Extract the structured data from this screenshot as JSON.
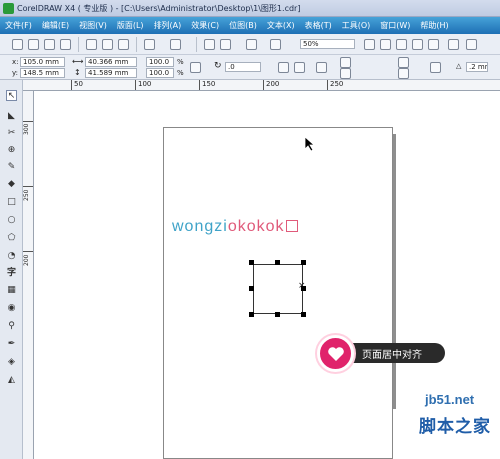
{
  "window": {
    "title": "CorelDRAW X4 ( 专业版 ) - [C:\\Users\\Administrator\\Desktop\\1\\图形1.cdr]"
  },
  "menu": [
    "文件(F)",
    "编辑(E)",
    "视图(V)",
    "版面(L)",
    "排列(A)",
    "效果(C)",
    "位图(B)",
    "文本(X)",
    "表格(T)",
    "工具(O)",
    "窗口(W)",
    "帮助(H)"
  ],
  "toolbar": {
    "zoom_value": "50%"
  },
  "property_bar": {
    "x_label": "x:",
    "x_value": "105.0 mm",
    "y_label": "y:",
    "y_value": "148.5 mm",
    "width_value": "40.366 mm",
    "height_value": "41.589 mm",
    "scale_x": "100.0",
    "scale_y": "100.0",
    "percent": "%",
    "rotation_value": ".0",
    "outline_value": ".2 mm"
  },
  "ruler": {
    "h_numbers": [
      "50",
      "100",
      "150",
      "200",
      "250"
    ],
    "v_numbers": [
      "300",
      "250",
      "200"
    ]
  },
  "canvas": {
    "logo_text_blue": "wongzi",
    "logo_text_pink": "okokok",
    "center_mark": "×"
  },
  "callout": {
    "text": "页面居中对齐"
  },
  "watermark": {
    "line1": "jb51.net",
    "line2": "脚本之家"
  },
  "colors": {
    "menubar": "#1e6fb5",
    "accent_pink": "#e0236b",
    "logo_blue": "#3fa3c8",
    "logo_pink": "#e05a7a"
  }
}
